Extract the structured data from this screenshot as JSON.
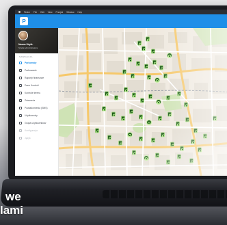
{
  "os_menubar": {
    "items": [
      "Finder",
      "File",
      "Edit",
      "View",
      "Przejdź",
      "Window",
      "Help"
    ]
  },
  "app": {
    "logo_letter": "P",
    "accent_color": "#1f8fe8"
  },
  "profile": {
    "name": "Nazwa Użytk.",
    "role": "Strefa Administratora"
  },
  "sidebar": {
    "section": "NAWIGACJA",
    "items": [
      {
        "label": "Parkomaty",
        "active": true
      },
      {
        "label": "Parkowanie",
        "active": false
      },
      {
        "label": "Raporty finansowe",
        "active": false
      },
      {
        "label": "Dane Kontroli",
        "active": false
      },
      {
        "label": "Kontrole terenu",
        "active": false
      },
      {
        "label": "Zdarzenia",
        "active": false
      },
      {
        "label": "Powiadomienia (SMS)",
        "active": false
      },
      {
        "label": "Użytkownicy",
        "active": false
      },
      {
        "label": "Grupa użytkowników",
        "active": false
      },
      {
        "label": "Konfiguracja",
        "active": false
      },
      {
        "label": "Język",
        "active": false
      }
    ]
  },
  "map": {
    "marker_color": "#1e5a1a"
  },
  "caption": {
    "line1": "we",
    "line2": "lami"
  }
}
